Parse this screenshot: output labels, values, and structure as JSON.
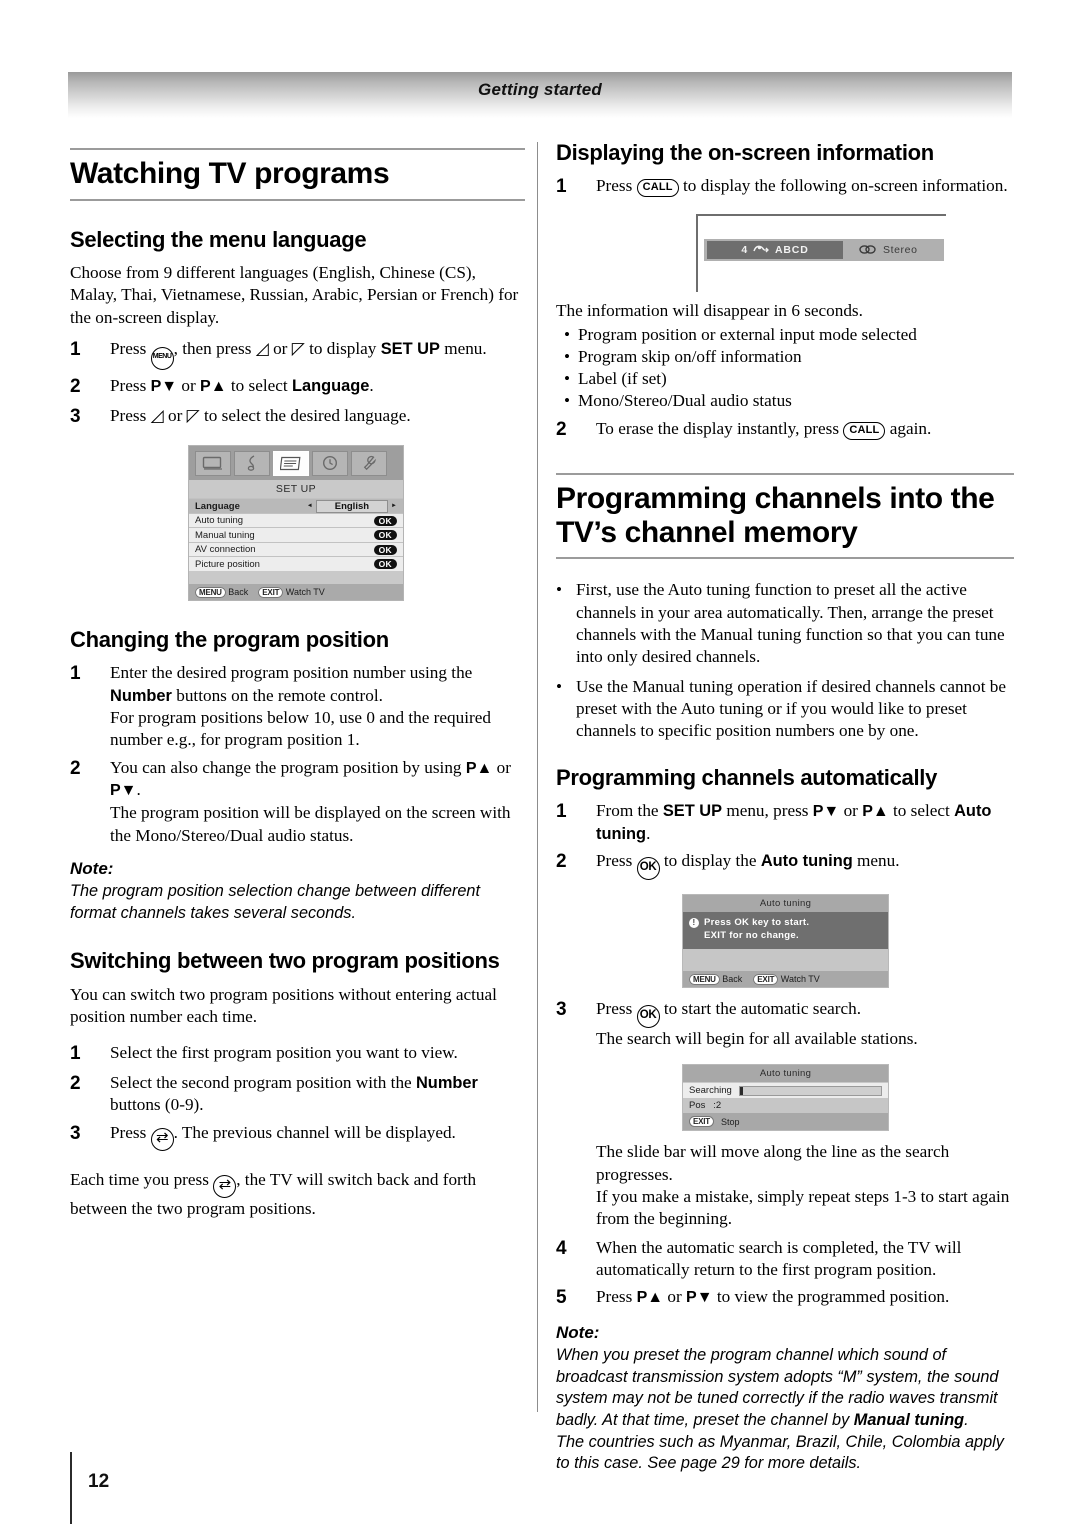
{
  "header": {
    "section_title": "Getting started"
  },
  "footer": {
    "page_number": "12"
  },
  "left": {
    "h1": "Watching TV programs",
    "selecting": {
      "heading": "Selecting the menu language",
      "intro": "Choose from 9 different languages (English, Chinese (CS), Malay, Thai, Vietnamese, Russian, Arabic, Persian or French) for the on-screen display.",
      "step1_a": "Press",
      "step1_b": ", then press",
      "step1_c": "or",
      "step1_d": "to display",
      "step1_e": "SET UP",
      "step1_f": "menu.",
      "step2_a": "Press",
      "step2_b": "P▼",
      "step2_c": "or",
      "step2_d": "P▲",
      "step2_e": "to select",
      "step2_f": "Language",
      "step2_g": ".",
      "step3_a": "Press",
      "step3_b": "or",
      "step3_c": "to select the desired language.",
      "n1": "1",
      "n2": "2",
      "n3": "3",
      "key_menu": "MENU"
    },
    "setup_osd": {
      "title": "SET UP",
      "icons": [
        "picture-icon",
        "sound-icon",
        "setup-icon",
        "timer-icon",
        "feature-icon"
      ],
      "rows": [
        {
          "label": "Language",
          "value": "English",
          "type": "value"
        },
        {
          "label": "Auto tuning",
          "value": "OK",
          "type": "ok"
        },
        {
          "label": "Manual tuning",
          "value": "OK",
          "type": "ok"
        },
        {
          "label": "AV connection",
          "value": "OK",
          "type": "ok"
        },
        {
          "label": "Picture position",
          "value": "OK",
          "type": "ok"
        }
      ],
      "foot_menu_key": "MENU",
      "foot_menu_label": "Back",
      "foot_exit_key": "EXIT",
      "foot_exit_label": "Watch TV",
      "arrow_left": "◄",
      "arrow_right": "►"
    },
    "changing": {
      "heading": "Changing the program position",
      "n1": "1",
      "n2": "2",
      "s1_l1a": "Enter the desired program position number using the",
      "s1_l1b": "Number",
      "s1_l1c": "buttons on the remote control.",
      "s1_l2": "For program positions below 10, use 0 and the required number e.g., for program position 1.",
      "s2_l1a": "You can also change the program position by using",
      "s2_pa": "P▲",
      "s2_or": "or",
      "s2_pv": "P▼",
      "s2_dot": ".",
      "s2_l2": "The program position will be displayed on the screen with the Mono/Stereo/Dual audio status.",
      "note_label": "Note:",
      "note_text": "The program position selection change between different format channels takes several seconds."
    },
    "switching": {
      "heading": "Switching between two program positions",
      "intro": "You can switch two program positions without entering actual position number each time.",
      "n1": "1",
      "n2": "2",
      "n3": "3",
      "s1": "Select the first program position you want to view.",
      "s2a": "Select the second program position with the",
      "s2b": "Number",
      "s2c": "buttons (0-9).",
      "s3a": "Press",
      "s3b": ". The previous channel will be displayed.",
      "closing_a": "Each time you press",
      "closing_b": ", the TV will switch back and forth between the two program positions.",
      "key_swap": "⇄"
    }
  },
  "right": {
    "displaying": {
      "heading": "Displaying the on-screen information",
      "n1": "1",
      "n2": "2",
      "s1a": "Press",
      "s1b": "to display the following on-screen information.",
      "after": "The information will disappear in 6 seconds.",
      "bullets": [
        "Program position or external input mode selected",
        "Program skip on/off information",
        "Label (if set)",
        "Mono/Stereo/Dual audio status"
      ],
      "s2a": "To erase the display instantly, press",
      "s2b": "again.",
      "key_call": "CALL",
      "bullet_char": "•"
    },
    "info_osd": {
      "position": "4",
      "skip_icon": "skip-off-icon",
      "label": "ABCD",
      "audio_icon": "stereo-icon",
      "audio": "Stereo"
    },
    "programming": {
      "h1_line1": "Programming channels into the",
      "h1_line2": "TV’s channel memory",
      "bullet_char": "•",
      "bullets": [
        "First, use the Auto tuning function to preset all the active channels in your area automatically. Then, arrange the preset channels with the Manual tuning function so that you can tune into only desired channels.",
        "Use the Manual tuning operation if desired channels cannot be preset with the Auto tuning or if you would like to preset channels to specific position numbers one by one."
      ]
    },
    "automatically": {
      "heading": "Programming channels automatically",
      "n1": "1",
      "n2": "2",
      "n3": "3",
      "n4": "4",
      "n5": "5",
      "s1a": "From the",
      "s1b": "SET UP",
      "s1c": "menu, press",
      "s1_pv": "P▼",
      "s1_or": "or",
      "s1_pa": "P▲",
      "s1d": "to select",
      "s1e": "Auto tuning",
      "s1f": ".",
      "s2a": "Press",
      "s2b": "to display the",
      "s2c": "Auto tuning",
      "s2d": "menu.",
      "s3_l1": "Press",
      "s3_l1b": "to start the automatic search.",
      "s3_l2": "The search will begin for all available stations.",
      "s3_after_l1": "The slide bar will move along the line as the search progresses.",
      "s3_after_l2": "If you make a mistake, simply repeat steps 1-3 to start again from the beginning.",
      "s4": "When the automatic search is completed, the TV will automatically return to the first program position.",
      "s5a": "Press",
      "s5_pa": "P▲",
      "s5_or": "or",
      "s5_pv": "P▼",
      "s5b": "to view the programmed position.",
      "key_ok": "OK",
      "note_label": "Note:",
      "note_text_a": "When you preset the program channel which sound of broadcast transmission system adopts “M” system, the sound system may not be tuned correctly if the radio waves transmit badly. At that time, preset the channel by ",
      "note_text_b": "Manual tuning",
      "note_text_c": ".",
      "note_text_d": "The countries such as Myanmar, Brazil, Chile, Colombia apply to this case. See page 29 for more details."
    },
    "auto_osd_1": {
      "title": "Auto tuning",
      "msg_line1": "Press OK key to start.",
      "msg_line2": "EXIT for no change.",
      "warn_icon": "!",
      "foot_menu_key": "MENU",
      "foot_menu_label": "Back",
      "foot_exit_key": "EXIT",
      "foot_exit_label": "Watch TV"
    },
    "auto_osd_2": {
      "title": "Auto tuning",
      "searching_label": "Searching",
      "progress_percent": 2,
      "pos_label": "Pos",
      "pos_value": ":2",
      "exit_key": "EXIT",
      "exit_label": "Stop"
    }
  }
}
